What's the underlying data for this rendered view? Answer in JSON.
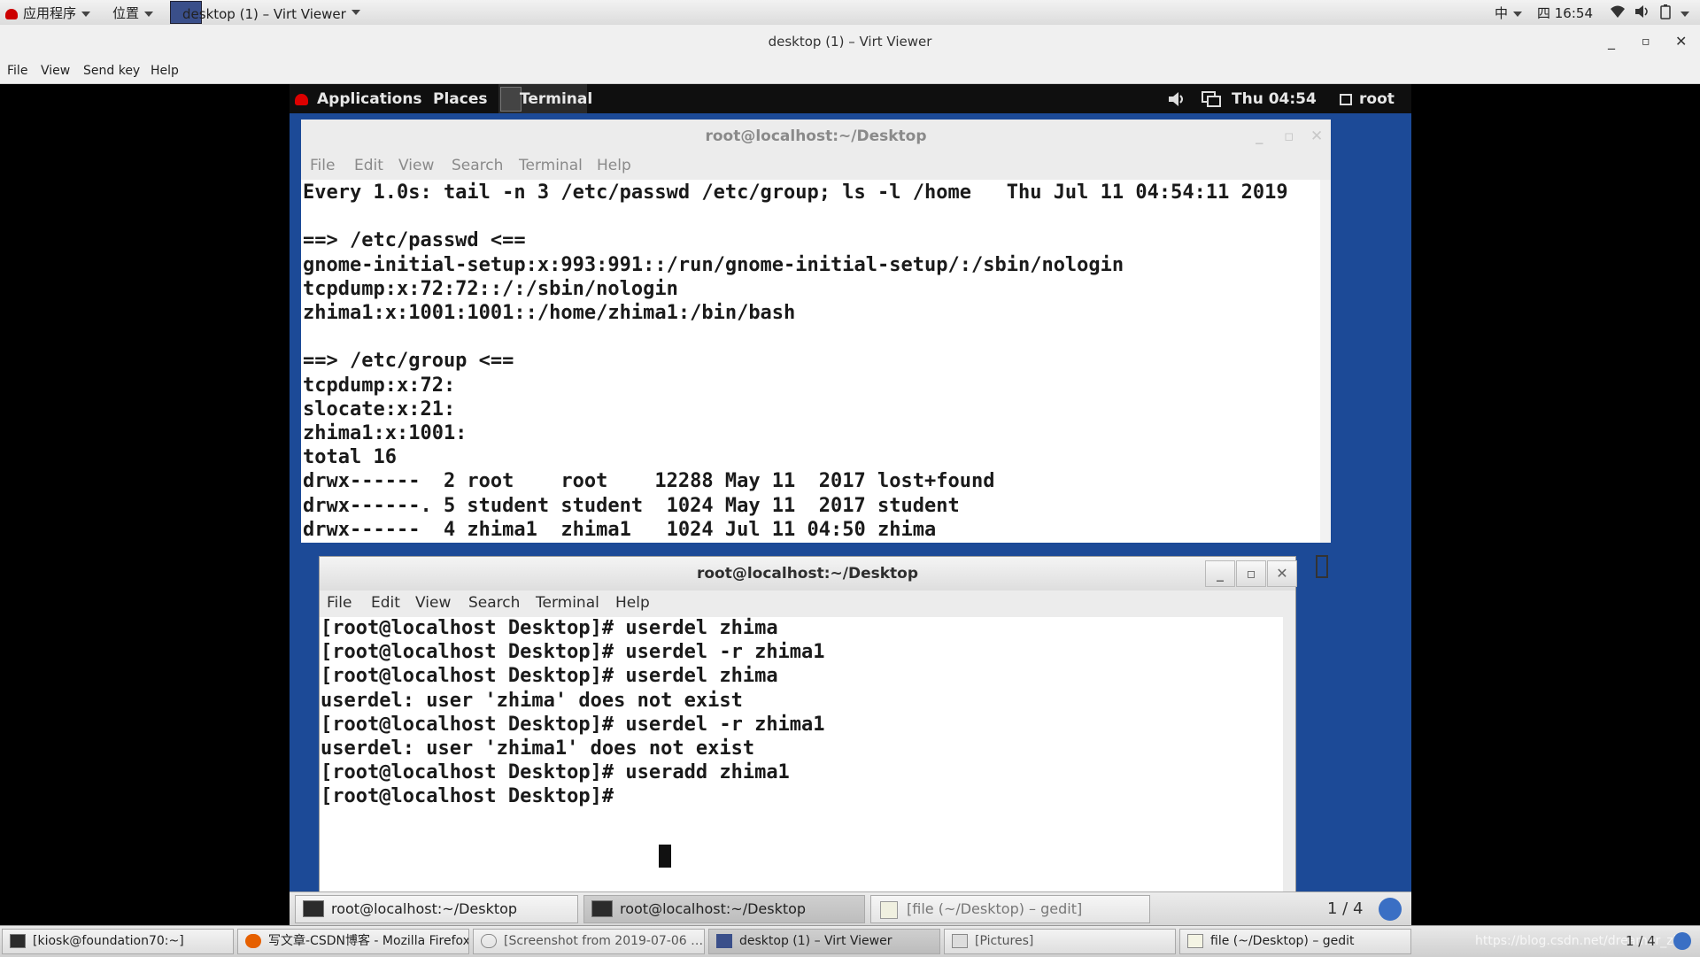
{
  "host_top": {
    "apps": "应用程序",
    "places": "位置",
    "window": "desktop (1) – Virt Viewer",
    "ime": "中",
    "clock": "四 16:54"
  },
  "virt_viewer": {
    "title": "desktop (1) – Virt Viewer",
    "menu": [
      "File",
      "View",
      "Send key",
      "Help"
    ]
  },
  "guest_top": {
    "applications": "Applications",
    "places": "Places",
    "terminal": "Terminal",
    "clock": "Thu 04:54",
    "user": "root"
  },
  "term1": {
    "title": "root@localhost:~/Desktop",
    "menu": [
      "File",
      "Edit",
      "View",
      "Search",
      "Terminal",
      "Help"
    ],
    "content": "Every 1.0s: tail -n 3 /etc/passwd /etc/group; ls -l /home   Thu Jul 11 04:54:11 2019\n\n==> /etc/passwd <==\ngnome-initial-setup:x:993:991::/run/gnome-initial-setup/:/sbin/nologin\ntcpdump:x:72:72::/:/sbin/nologin\nzhima1:x:1001:1001::/home/zhima1:/bin/bash\n\n==> /etc/group <==\ntcpdump:x:72:\nslocate:x:21:\nzhima1:x:1001:\ntotal 16\ndrwx------  2 root    root    12288 May 11  2017 lost+found\ndrwx------. 5 student student  1024 May 11  2017 student\ndrwx------  4 zhima1  zhima1   1024 Jul 11 04:50 zhima"
  },
  "term2": {
    "title": "root@localhost:~/Desktop",
    "menu": [
      "File",
      "Edit",
      "View",
      "Search",
      "Terminal",
      "Help"
    ],
    "content": "[root@localhost Desktop]# userdel zhima\n[root@localhost Desktop]# userdel -r zhima1\n[root@localhost Desktop]# userdel zhima\nuserdel: user 'zhima' does not exist\n[root@localhost Desktop]# userdel -r zhima1\nuserdel: user 'zhima1' does not exist\n[root@localhost Desktop]# useradd zhima1\n[root@localhost Desktop]# "
  },
  "guest_taskbar": {
    "items": [
      "root@localhost:~/Desktop",
      "root@localhost:~/Desktop",
      "[file (~/Desktop) – gedit]"
    ],
    "pager": "1 / 4"
  },
  "host_taskbar": {
    "items": [
      "[kiosk@foundation70:~]",
      "写文章-CSDN博客 - Mozilla Firefox",
      "[Screenshot from 2019-07-06 …",
      "desktop (1) – Virt Viewer",
      "[Pictures]",
      "file (~/Desktop) – gedit"
    ],
    "pager": "1 / 4",
    "watermark": "https://blog.csdn.net/dreamer_zh"
  },
  "colors": {
    "guest_bg": "#1c4a97",
    "panel_dark": "#0f0f0f"
  }
}
